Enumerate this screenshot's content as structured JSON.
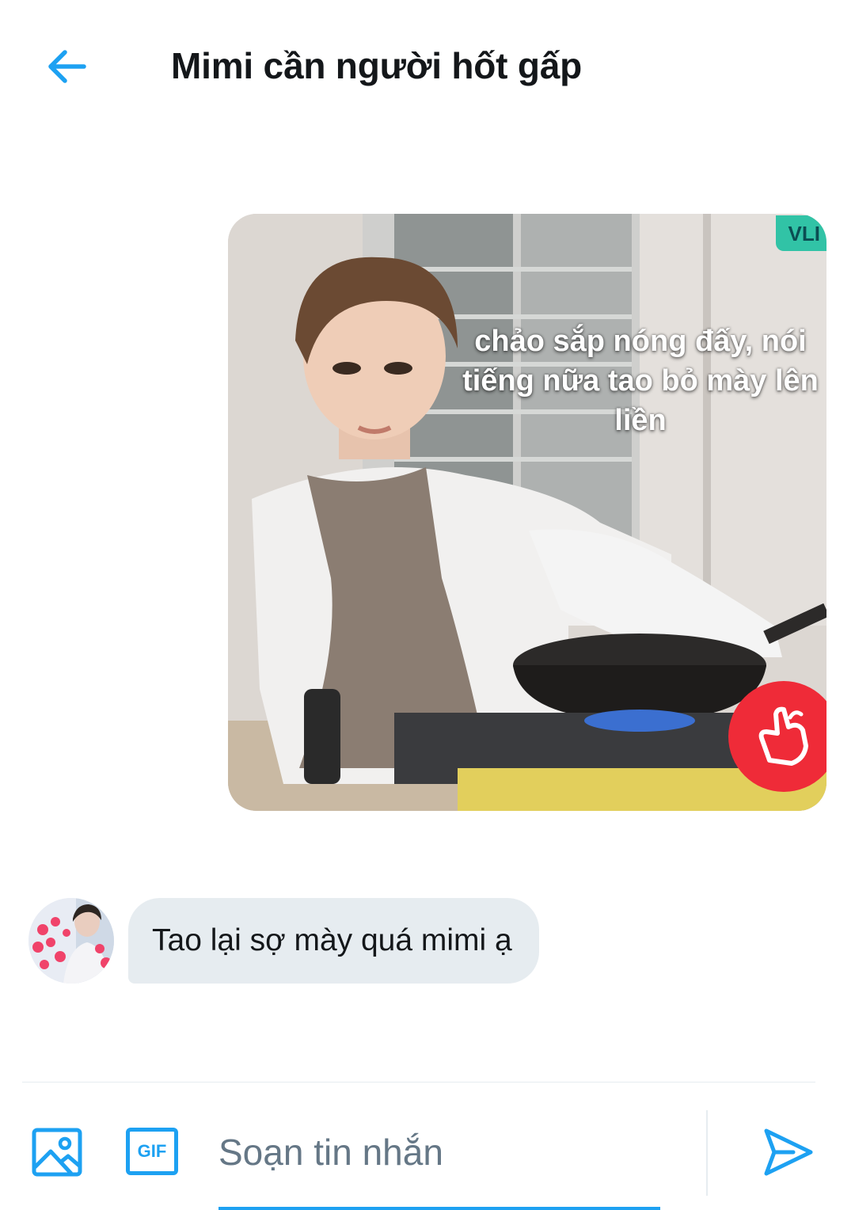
{
  "header": {
    "title": "Mimi cần người hốt gấp",
    "back_icon": "arrow-left-icon"
  },
  "messages": {
    "sent_image": {
      "caption": "chảo sắp nóng đấy, nói tiếng nữa tao bỏ mày lên liền",
      "watermark": "VLI",
      "badge_icon": "finger-heart-icon"
    },
    "received": {
      "text": "Tao lại sợ mày quá mimi ạ",
      "avatar_icon": "user-avatar"
    }
  },
  "composer": {
    "placeholder": "Soạn tin nhắn",
    "value": "",
    "gif_label": "GIF",
    "media_icon": "image-icon",
    "send_icon": "send-icon"
  },
  "colors": {
    "accent": "#1da1f2",
    "bubble": "#e6ecf0",
    "text": "#14171a",
    "placeholder": "#657786",
    "badge": "#ef2b38"
  }
}
